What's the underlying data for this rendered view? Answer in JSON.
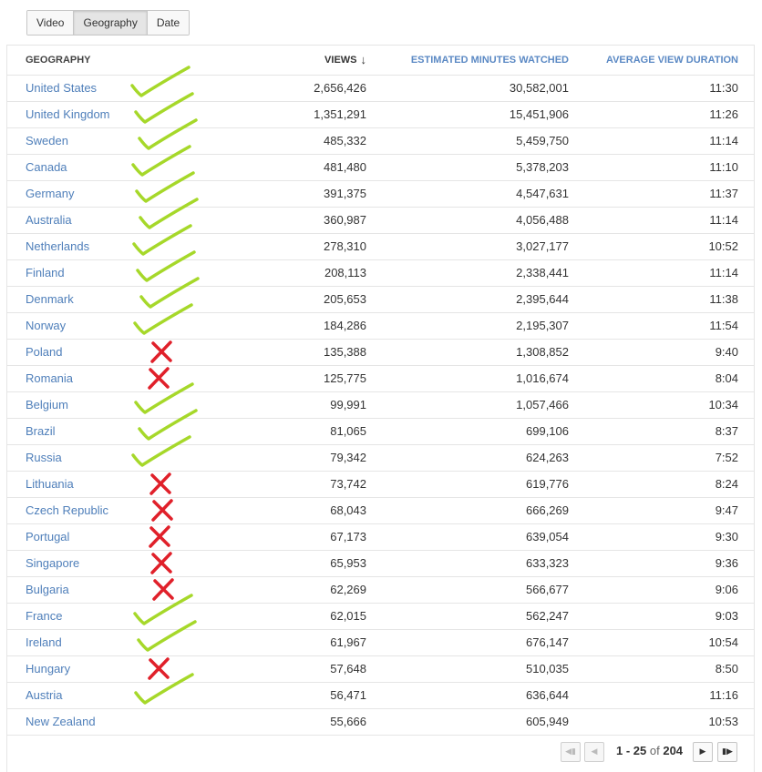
{
  "tabs": [
    {
      "label": "Video",
      "active": false
    },
    {
      "label": "Geography",
      "active": true
    },
    {
      "label": "Date",
      "active": false
    }
  ],
  "table": {
    "headers": {
      "geography": "GEOGRAPHY",
      "views": "VIEWS",
      "minutes": "ESTIMATED MINUTES WATCHED",
      "avg": "AVERAGE VIEW DURATION"
    },
    "sort_icon": "arrow-down-icon",
    "rows": [
      {
        "country": "United States",
        "views": "2,656,426",
        "minutes": "30,582,001",
        "avg": "11:30",
        "mark": "check"
      },
      {
        "country": "United Kingdom",
        "views": "1,351,291",
        "minutes": "15,451,906",
        "avg": "11:26",
        "mark": "check"
      },
      {
        "country": "Sweden",
        "views": "485,332",
        "minutes": "5,459,750",
        "avg": "11:14",
        "mark": "check"
      },
      {
        "country": "Canada",
        "views": "481,480",
        "minutes": "5,378,203",
        "avg": "11:10",
        "mark": "check"
      },
      {
        "country": "Germany",
        "views": "391,375",
        "minutes": "4,547,631",
        "avg": "11:37",
        "mark": "check"
      },
      {
        "country": "Australia",
        "views": "360,987",
        "minutes": "4,056,488",
        "avg": "11:14",
        "mark": "check"
      },
      {
        "country": "Netherlands",
        "views": "278,310",
        "minutes": "3,027,177",
        "avg": "10:52",
        "mark": "check"
      },
      {
        "country": "Finland",
        "views": "208,113",
        "minutes": "2,338,441",
        "avg": "11:14",
        "mark": "check"
      },
      {
        "country": "Denmark",
        "views": "205,653",
        "minutes": "2,395,644",
        "avg": "11:38",
        "mark": "check"
      },
      {
        "country": "Norway",
        "views": "184,286",
        "minutes": "2,195,307",
        "avg": "11:54",
        "mark": "check"
      },
      {
        "country": "Poland",
        "views": "135,388",
        "minutes": "1,308,852",
        "avg": "9:40",
        "mark": "cross"
      },
      {
        "country": "Romania",
        "views": "125,775",
        "minutes": "1,016,674",
        "avg": "8:04",
        "mark": "cross"
      },
      {
        "country": "Belgium",
        "views": "99,991",
        "minutes": "1,057,466",
        "avg": "10:34",
        "mark": "check"
      },
      {
        "country": "Brazil",
        "views": "81,065",
        "minutes": "699,106",
        "avg": "8:37",
        "mark": "check"
      },
      {
        "country": "Russia",
        "views": "79,342",
        "minutes": "624,263",
        "avg": "7:52",
        "mark": "check"
      },
      {
        "country": "Lithuania",
        "views": "73,742",
        "minutes": "619,776",
        "avg": "8:24",
        "mark": "cross"
      },
      {
        "country": "Czech Republic",
        "views": "68,043",
        "minutes": "666,269",
        "avg": "9:47",
        "mark": "cross"
      },
      {
        "country": "Portugal",
        "views": "67,173",
        "minutes": "639,054",
        "avg": "9:30",
        "mark": "cross"
      },
      {
        "country": "Singapore",
        "views": "65,953",
        "minutes": "633,323",
        "avg": "9:36",
        "mark": "cross"
      },
      {
        "country": "Bulgaria",
        "views": "62,269",
        "minutes": "566,677",
        "avg": "9:06",
        "mark": "cross"
      },
      {
        "country": "France",
        "views": "62,015",
        "minutes": "562,247",
        "avg": "9:03",
        "mark": "check"
      },
      {
        "country": "Ireland",
        "views": "61,967",
        "minutes": "676,147",
        "avg": "10:54",
        "mark": "check"
      },
      {
        "country": "Hungary",
        "views": "57,648",
        "minutes": "510,035",
        "avg": "8:50",
        "mark": "cross"
      },
      {
        "country": "Austria",
        "views": "56,471",
        "minutes": "636,644",
        "avg": "11:16",
        "mark": "check"
      },
      {
        "country": "New Zealand",
        "views": "55,666",
        "minutes": "605,949",
        "avg": "10:53",
        "mark": "none"
      }
    ]
  },
  "pagination": {
    "range_start": "1",
    "range_sep": " - ",
    "range_end": "25",
    "of_label": " of ",
    "total": "204",
    "first_icon": "first-page-icon",
    "prev_icon": "prev-page-icon",
    "next_icon": "next-page-icon",
    "last_icon": "last-page-icon"
  },
  "colors": {
    "link": "#4f7fba",
    "header_accent": "#5b89c4",
    "check_mark": "#a6d82a",
    "cross_mark": "#e0202a",
    "row_border": "#e5e5e5"
  }
}
